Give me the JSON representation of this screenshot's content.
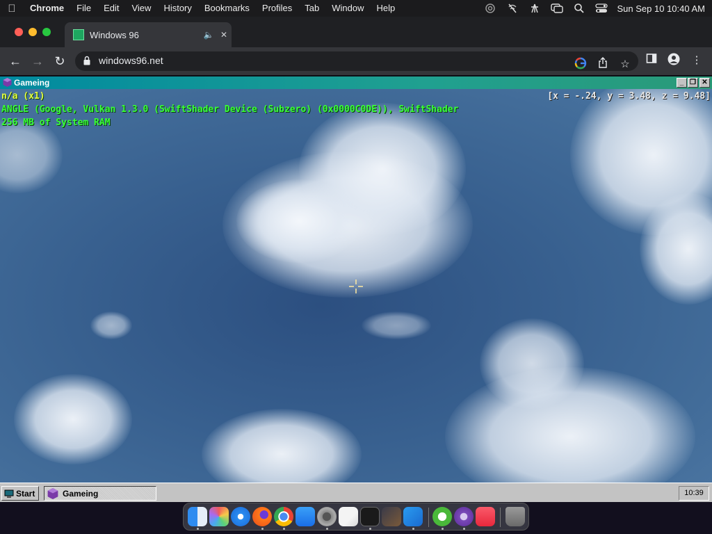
{
  "menubar": {
    "app_name": "Chrome",
    "items": [
      "File",
      "Edit",
      "View",
      "History",
      "Bookmarks",
      "Profiles",
      "Tab",
      "Window",
      "Help"
    ],
    "clock": "Sun Sep 10  10:40 AM"
  },
  "browser": {
    "tab_title": "Windows 96",
    "url": "windows96.net"
  },
  "win96": {
    "window_title": "Gameing",
    "hud_lines": [
      "n/a (x1)",
      "ANGLE (Google, Vulkan 1.3.0 (SwiftShader Device (Subzero) (0x0000C0DE)), SwiftShader",
      "256 MB of System RAM"
    ],
    "coords": "[x = -.24, y = 3.48, z = 9.48]",
    "taskbar": {
      "start_label": "Start",
      "task_label": "Gameing",
      "tray_clock": "10:39"
    }
  },
  "colors": {
    "hud_green": "#39ff38",
    "hud_yellow": "#e6ff40",
    "title_gradient_start": "#008aa0",
    "sky_blue": "#38608f"
  },
  "dock": {
    "apps": [
      "finder-icon",
      "launchpad-icon",
      "safari-icon",
      "firefox-icon",
      "chrome-icon",
      "app-store-icon",
      "system-settings-icon",
      "textedit-icon",
      "terminal-icon",
      "instruments-icon",
      "vscode-icon",
      "utorrent-icon",
      "tor-browser-icon",
      "music-icon",
      "trash-icon"
    ]
  }
}
